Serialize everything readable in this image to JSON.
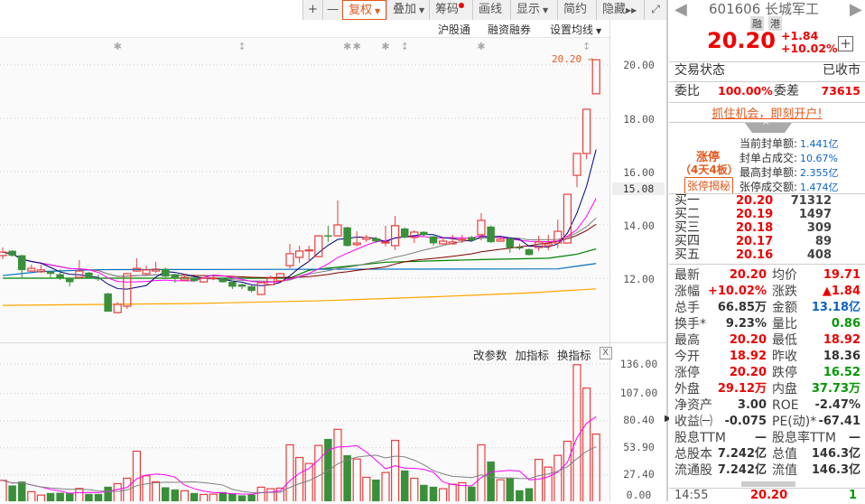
{
  "toolbar": {
    "zoom_in": "+",
    "zoom_out": "—",
    "fuquan": "复权",
    "overlay": "叠加",
    "chips": "筹码",
    "draw": "画线",
    "display": "显示",
    "simple": "简约",
    "hide": "隐藏",
    "fullscreen_icon": "fullscreen-icon"
  },
  "subbar": {
    "hgt": "沪股通",
    "margin": "融资融券",
    "set_ma": "设置均线"
  },
  "price_axis": {
    "labels": [
      "20.00",
      "18.00",
      "16.00",
      "14.00",
      "12.00"
    ],
    "ticks": [
      20,
      18,
      16,
      14,
      12
    ],
    "cursor_label": "15.08",
    "last_label": "20.20"
  },
  "volume_panel": {
    "btn_params": "改参数",
    "btn_add": "加指标",
    "btn_switch": "换指标",
    "close": "X",
    "labels": [
      "136.00",
      "107.00",
      "80.40",
      "53.90",
      "27.40",
      "0.00"
    ],
    "ticks": [
      136,
      107,
      80.4,
      53.9,
      27.4,
      0
    ]
  },
  "colors": {
    "up": "#e83e3e",
    "down": "#3a8f3a",
    "ma5": "#000080",
    "ma10": "#ff00ff",
    "ma20": "#808080",
    "ma30": "#800000",
    "accent": "#e4581c"
  },
  "chart_data": {
    "type": "candlestick",
    "ylim": [
      10.6,
      20.4
    ],
    "vol_ylim": [
      0,
      136
    ],
    "candles": [
      [
        12.85,
        13.15,
        12.71,
        12.98
      ],
      [
        13.02,
        13.05,
        12.81,
        12.85
      ],
      [
        12.85,
        12.88,
        12.03,
        12.31
      ],
      [
        12.27,
        12.51,
        12.24,
        12.37
      ],
      [
        12.24,
        12.51,
        12.2,
        12.31
      ],
      [
        12.24,
        12.27,
        12.0,
        12.17
      ],
      [
        12.14,
        12.34,
        11.93,
        12.03
      ],
      [
        12.0,
        12.03,
        11.69,
        11.86
      ],
      [
        12.03,
        12.68,
        12.0,
        12.27
      ],
      [
        12.2,
        12.24,
        12.0,
        12.03
      ],
      [
        12.0,
        12.14,
        11.9,
        11.97
      ],
      [
        11.42,
        11.45,
        10.75,
        10.75
      ],
      [
        10.71,
        11.1,
        10.68,
        11.02
      ],
      [
        10.95,
        12.2,
        10.85,
        12.17
      ],
      [
        12.27,
        12.75,
        12.24,
        12.37
      ],
      [
        12.17,
        12.47,
        12.14,
        12.31
      ],
      [
        12.27,
        12.61,
        12.2,
        12.34
      ],
      [
        12.34,
        12.4,
        12.03,
        12.07
      ],
      [
        12.14,
        12.17,
        11.83,
        12.0
      ],
      [
        11.93,
        12.17,
        11.9,
        12.03
      ],
      [
        12.0,
        12.03,
        11.86,
        11.9
      ],
      [
        11.86,
        12.03,
        11.83,
        12.0
      ],
      [
        12.0,
        12.07,
        11.93,
        12.01
      ],
      [
        11.97,
        12.0,
        11.83,
        11.86
      ],
      [
        11.86,
        11.9,
        11.59,
        11.69
      ],
      [
        11.76,
        11.8,
        11.59,
        11.69
      ],
      [
        11.69,
        11.73,
        11.46,
        11.53
      ],
      [
        11.39,
        11.86,
        11.36,
        11.83
      ],
      [
        11.76,
        12.1,
        11.73,
        12.0
      ],
      [
        11.9,
        12.2,
        11.86,
        12.17
      ],
      [
        12.47,
        13.29,
        12.37,
        12.92
      ],
      [
        12.78,
        13.22,
        12.58,
        13.02
      ],
      [
        13.05,
        13.22,
        12.61,
        13.06
      ],
      [
        12.81,
        13.62,
        12.78,
        13.59
      ],
      [
        13.6,
        13.97,
        13.36,
        13.59
      ],
      [
        13.59,
        14.92,
        13.56,
        14.0
      ],
      [
        13.9,
        13.93,
        13.19,
        13.22
      ],
      [
        13.26,
        13.76,
        13.19,
        13.32
      ],
      [
        13.46,
        13.63,
        13.36,
        13.53
      ],
      [
        13.49,
        13.56,
        13.32,
        13.39
      ],
      [
        13.32,
        13.97,
        13.19,
        13.36
      ],
      [
        13.22,
        14.34,
        13.05,
        13.97
      ],
      [
        13.86,
        13.9,
        13.49,
        13.53
      ],
      [
        13.53,
        13.8,
        13.32,
        13.73
      ],
      [
        13.73,
        13.76,
        13.56,
        13.63
      ],
      [
        13.56,
        13.59,
        13.22,
        13.32
      ],
      [
        13.29,
        13.53,
        13.26,
        13.39
      ],
      [
        13.29,
        13.63,
        13.26,
        13.36
      ],
      [
        13.45,
        13.63,
        13.32,
        13.46
      ],
      [
        13.53,
        13.59,
        13.39,
        13.42
      ],
      [
        13.63,
        14.44,
        13.42,
        14.17
      ],
      [
        13.93,
        13.97,
        13.32,
        13.36
      ],
      [
        13.39,
        13.53,
        13.36,
        13.46
      ],
      [
        13.49,
        13.53,
        12.95,
        13.15
      ],
      [
        13.16,
        13.29,
        13.05,
        13.15
      ],
      [
        13.08,
        13.12,
        12.85,
        12.88
      ],
      [
        13.15,
        13.59,
        13.02,
        13.36
      ],
      [
        13.22,
        13.63,
        13.05,
        13.29
      ],
      [
        13.32,
        14.2,
        13.12,
        13.76
      ],
      [
        13.32,
        15.15,
        13.3,
        15.15
      ],
      [
        15.86,
        16.7,
        15.42,
        16.68
      ],
      [
        16.68,
        18.36,
        16.47,
        18.34
      ],
      [
        18.92,
        20.2,
        18.92,
        20.2
      ]
    ],
    "volumes": [
      22,
      16.8,
      20.6,
      10.9,
      7.6,
      9.4,
      9.7,
      9.1,
      14.1,
      8.5,
      8.5,
      15.6,
      18.8,
      24.1,
      50.6,
      26.5,
      20.6,
      15,
      12.9,
      11.8,
      9.4,
      8.2,
      8.5,
      10.3,
      8.8,
      7.1,
      7.9,
      15.3,
      13.8,
      14.4,
      56.8,
      44.4,
      38.5,
      56.2,
      62.4,
      72,
      46.5,
      42.9,
      25,
      22.6,
      29.7,
      61.2,
      31.5,
      24.1,
      17.4,
      15.6,
      13.8,
      18.2,
      19.7,
      15.6,
      56.8,
      40.3,
      22.6,
      23.8,
      12.1,
      14.1,
      42.6,
      35,
      46.5,
      60.3,
      135.3,
      112.4,
      67.4
    ],
    "ma_periods": [
      5,
      10,
      20,
      30
    ],
    "vol_ma_periods": [
      5,
      10
    ],
    "long_ma_lines": [
      {
        "name": "ma-green",
        "color": "#008000",
        "points": [
          [
            0,
            12.0
          ],
          [
            30,
            12.0
          ],
          [
            32,
            12.3
          ],
          [
            40,
            12.6
          ],
          [
            50,
            12.7
          ],
          [
            57,
            12.75
          ],
          [
            60,
            12.9
          ],
          [
            62,
            13.1
          ]
        ]
      },
      {
        "name": "ma-blue",
        "color": "#0070c0",
        "points": [
          [
            0,
            12.1
          ],
          [
            4,
            12.25
          ],
          [
            10,
            12.32
          ],
          [
            58,
            12.35
          ],
          [
            62,
            12.55
          ]
        ]
      },
      {
        "name": "ma-orange",
        "color": "#ffa500",
        "points": [
          [
            0,
            10.98
          ],
          [
            20,
            11.05
          ],
          [
            33,
            11.15
          ],
          [
            45,
            11.3
          ],
          [
            55,
            11.45
          ],
          [
            62,
            11.6
          ]
        ]
      }
    ],
    "event_markers": [
      {
        "i": 12,
        "glyph": "✱"
      },
      {
        "i": 25,
        "glyph": "↕"
      },
      {
        "i": 36,
        "glyph": "✱"
      },
      {
        "i": 37,
        "glyph": "✱"
      },
      {
        "i": 40,
        "glyph": "✱"
      },
      {
        "i": 42,
        "glyph": "↕"
      },
      {
        "i": 50,
        "glyph": "✱"
      },
      {
        "i": 61,
        "glyph": "↕"
      }
    ]
  },
  "stock": {
    "code_name": "601606 长城军工",
    "tag1": "融",
    "tag2": "港",
    "price": "20.20",
    "change": "+1.84",
    "change_pct": "+10.02%",
    "status_label": "交易状态",
    "status_value": "已收市",
    "wb_label": "委比",
    "wb_value": "100.00%",
    "wc_label": "委差",
    "wc_value": "73615",
    "promo": "抓住机会，即刻开户!"
  },
  "limit_up": {
    "title": "涨停",
    "boards": "（4天4板）",
    "btn": "张停揭秘",
    "items": [
      {
        "label": "当前封单额:",
        "value": "1.441亿"
      },
      {
        "label": "封单占成交:",
        "value": "10.67%"
      },
      {
        "label": "最高封单额:",
        "value": "2.355亿"
      },
      {
        "label": "张停成交额:",
        "value": "1.474亿"
      }
    ]
  },
  "bids": [
    {
      "label": "买一",
      "price": "20.20",
      "vol": "71312"
    },
    {
      "label": "买二",
      "price": "20.19",
      "vol": "1497"
    },
    {
      "label": "买三",
      "price": "20.18",
      "vol": "309"
    },
    {
      "label": "买四",
      "price": "20.17",
      "vol": "89"
    },
    {
      "label": "买五",
      "price": "20.16",
      "vol": "408"
    }
  ],
  "stats": [
    {
      "l1": "最新",
      "v1": "20.20",
      "c1": "red",
      "l2": "均价",
      "v2": "19.71",
      "c2": "red"
    },
    {
      "l1": "涨幅",
      "v1": "+10.02%",
      "c1": "red",
      "l2": "涨跌",
      "v2": "▲1.84",
      "c2": "red"
    },
    {
      "l1": "总手",
      "v1": "66.85万",
      "c1": "dk",
      "l2": "金额",
      "v2": "13.18亿",
      "c2": "blue"
    },
    {
      "l1": "换手*",
      "v1": "9.23%",
      "c1": "dk",
      "l2": "量比",
      "v2": "0.86",
      "c2": "green"
    },
    {
      "l1": "最高",
      "v1": "20.20",
      "c1": "red",
      "l2": "最低",
      "v2": "18.92",
      "c2": "red"
    },
    {
      "l1": "今开",
      "v1": "18.92",
      "c1": "red",
      "l2": "昨收",
      "v2": "18.36",
      "c2": "dk"
    },
    {
      "l1": "涨停",
      "v1": "20.20",
      "c1": "red",
      "l2": "跌停",
      "v2": "16.52",
      "c2": "green"
    },
    {
      "l1": "外盘",
      "v1": "29.12万",
      "c1": "red",
      "l2": "内盘",
      "v2": "37.73万",
      "c2": "green"
    },
    {
      "l1": "净资产",
      "v1": "3.00",
      "c1": "dk",
      "l2": "ROE",
      "v2": "-2.47%",
      "c2": "dk"
    },
    {
      "l1": "收益㈠",
      "v1": "-0.075",
      "c1": "dk",
      "l2": "PE(动)*",
      "v2": "-67.41",
      "c2": "dk"
    },
    {
      "l1": "股息TTM",
      "v1": "—",
      "c1": "dk",
      "l2": "股息率TTM",
      "v2": "—",
      "c2": "dk"
    },
    {
      "l1": "总股本",
      "v1": "7.242亿",
      "c1": "dk",
      "l2": "总值",
      "v2": "146.3亿",
      "c2": "dk"
    },
    {
      "l1": "流通股",
      "v1": "7.242亿",
      "c1": "dk",
      "l2": "流值",
      "v2": "146.3亿",
      "c2": "dk"
    }
  ],
  "tick": {
    "time": "14:55",
    "price": "20.20",
    "vol": "1"
  }
}
